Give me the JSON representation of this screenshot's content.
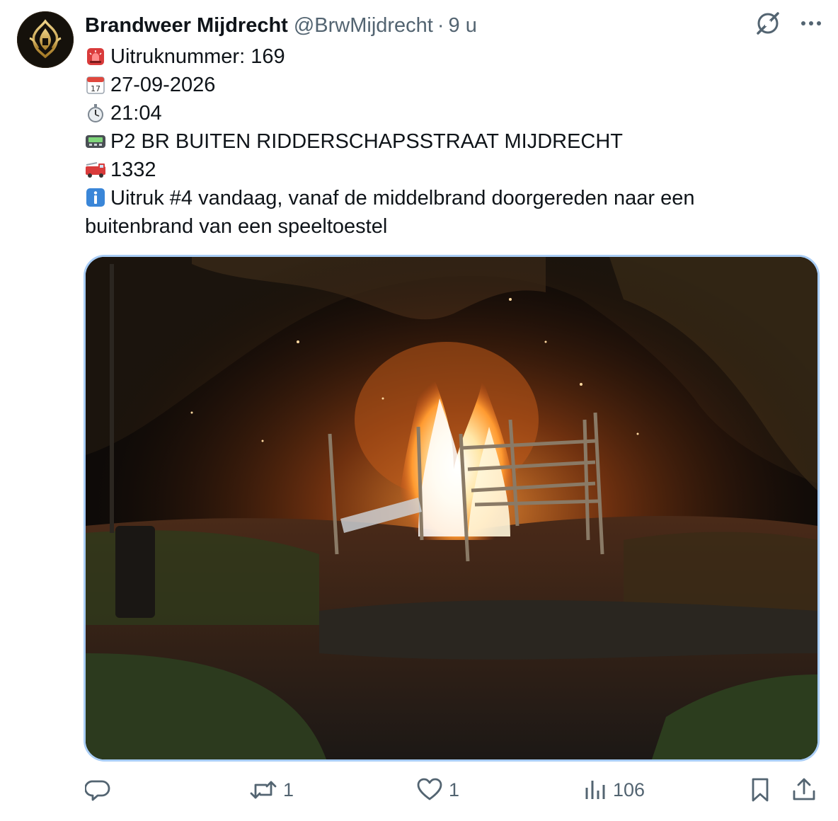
{
  "tweet": {
    "author_name": "Brandweer Mijdrecht",
    "author_handle": "@BrwMijdrecht",
    "separator": "·",
    "timestamp": "9 u",
    "lines": {
      "incident_number": "Uitruknummer: 169",
      "date": "27-09-2026",
      "time": "21:04",
      "pager": "P2 BR BUITEN RIDDERSCHAPSSTRAAT MIJDRECHT",
      "vehicle": "1332",
      "info": "Uitruk #4 vandaag, vanaf de middelbrand doorgereden naar een buitenbrand van een speeltoestel"
    },
    "emoji_icons": [
      "police-light-icon",
      "calendar-icon",
      "stopwatch-icon",
      "pager-icon",
      "fire-engine-icon",
      "information-icon"
    ],
    "calendar_day": "17"
  },
  "actions": {
    "reply_count": "",
    "retweet_count": "1",
    "like_count": "1",
    "views_count": "106"
  },
  "colors": {
    "text": "#0f1419",
    "secondary": "#536471",
    "media_border": "#a9cdf5",
    "avatar_gold": "#c9a24a"
  }
}
